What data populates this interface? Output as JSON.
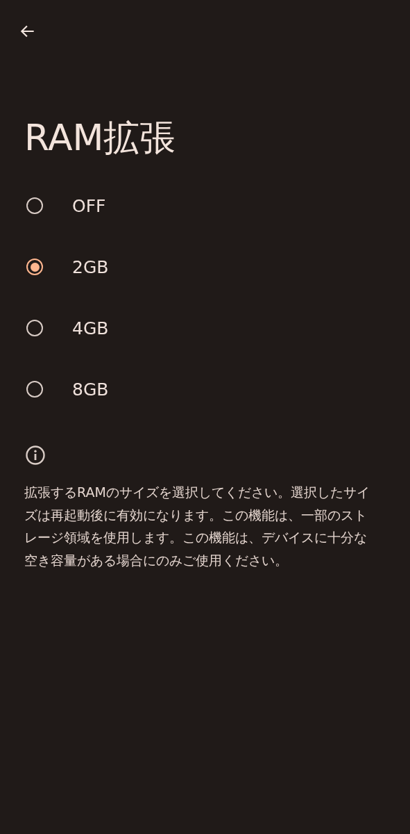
{
  "title": "RAM拡張",
  "options": [
    {
      "label": "OFF",
      "selected": false
    },
    {
      "label": "2GB",
      "selected": true
    },
    {
      "label": "4GB",
      "selected": false
    },
    {
      "label": "8GB",
      "selected": false
    }
  ],
  "description": "拡張するRAMのサイズを選択してください。選択したサイズは再起動後に有効になります。この機能は、一部のストレージ領域を使用します。この機能は、デバイスに十分な空き容量がある場合にのみご使用ください。"
}
